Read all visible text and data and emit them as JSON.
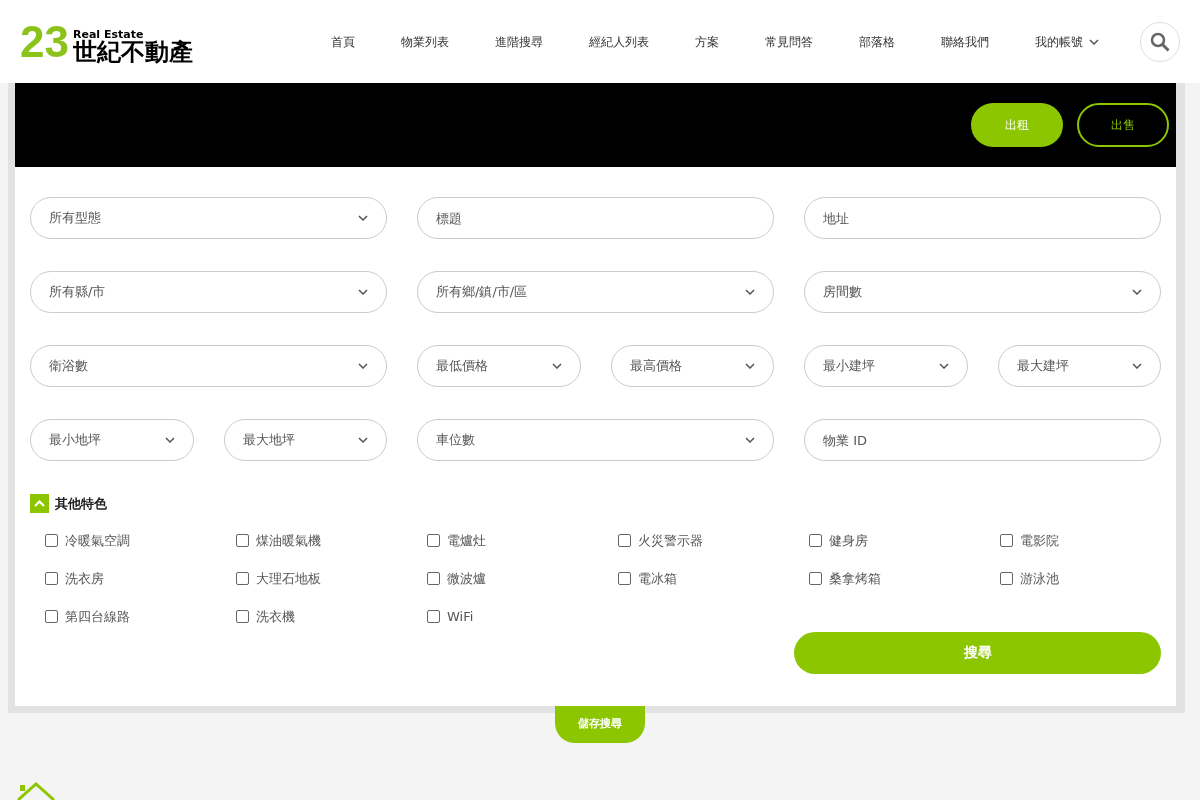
{
  "logo": {
    "number": "23",
    "tagline": "Real Estate",
    "name": "世紀不動產"
  },
  "nav": [
    {
      "label": "首頁",
      "dropdown": false
    },
    {
      "label": "物業列表",
      "dropdown": false
    },
    {
      "label": "進階搜尋",
      "dropdown": false
    },
    {
      "label": "經紀人列表",
      "dropdown": false
    },
    {
      "label": "方案",
      "dropdown": false
    },
    {
      "label": "常見問答",
      "dropdown": false
    },
    {
      "label": "部落格",
      "dropdown": false
    },
    {
      "label": "聯絡我們",
      "dropdown": false
    },
    {
      "label": "我的帳號",
      "dropdown": true
    }
  ],
  "tabs": [
    {
      "label": "出租",
      "selected": true
    },
    {
      "label": "出售",
      "selected": false
    }
  ],
  "fields": [
    {
      "kind": "select",
      "placeholder": "所有型態",
      "wide": true
    },
    {
      "kind": "text",
      "placeholder": "標題",
      "wide": true
    },
    {
      "kind": "text",
      "placeholder": "地址",
      "wide": true
    },
    {
      "kind": "select",
      "placeholder": "所有縣/市",
      "wide": true
    },
    {
      "kind": "select",
      "placeholder": "所有鄉/鎮/市/區",
      "wide": true
    },
    {
      "kind": "select",
      "placeholder": "房間數",
      "wide": true
    },
    {
      "kind": "select",
      "placeholder": "衛浴數",
      "wide": true
    },
    {
      "kind": "select",
      "placeholder": "最低價格",
      "wide": false
    },
    {
      "kind": "select",
      "placeholder": "最高價格",
      "wide": false
    },
    {
      "kind": "select",
      "placeholder": "最小建坪",
      "wide": false
    },
    {
      "kind": "select",
      "placeholder": "最大建坪",
      "wide": false
    },
    {
      "kind": "select",
      "placeholder": "最小地坪",
      "wide": false
    },
    {
      "kind": "select",
      "placeholder": "最大地坪",
      "wide": false
    },
    {
      "kind": "select",
      "placeholder": "車位數",
      "wide": true
    },
    {
      "kind": "text",
      "placeholder": "物業 ID",
      "wide": true
    }
  ],
  "features": {
    "title": "其他特色",
    "expanded": true,
    "items": [
      {
        "label": "冷暖氣空調",
        "checked": false
      },
      {
        "label": "煤油暖氣機",
        "checked": false
      },
      {
        "label": "電爐灶",
        "checked": false
      },
      {
        "label": "火災警示器",
        "checked": false
      },
      {
        "label": "健身房",
        "checked": false
      },
      {
        "label": "電影院",
        "checked": false
      },
      {
        "label": "洗衣房",
        "checked": false
      },
      {
        "label": "大理石地板",
        "checked": false
      },
      {
        "label": "微波爐",
        "checked": false
      },
      {
        "label": "電冰箱",
        "checked": false
      },
      {
        "label": "桑拿烤箱",
        "checked": false
      },
      {
        "label": "游泳池",
        "checked": false
      },
      {
        "label": "第四台線路",
        "checked": false
      },
      {
        "label": "洗衣機",
        "checked": false
      },
      {
        "label": "WiFi",
        "checked": false
      }
    ]
  },
  "search_button": "搜尋",
  "save_search": "儲存搜尋"
}
